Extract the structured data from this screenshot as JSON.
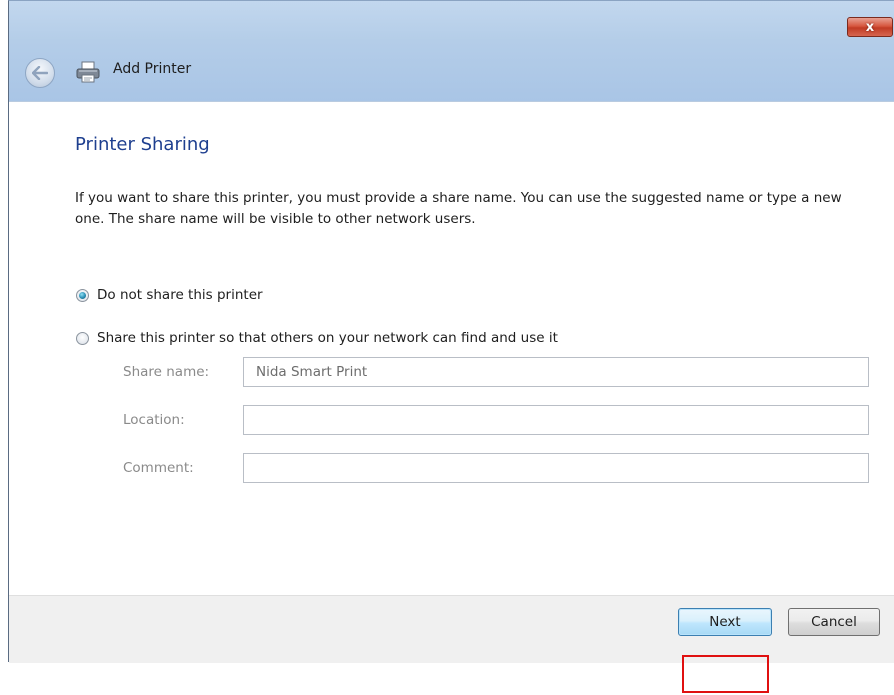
{
  "window": {
    "title": "Add Printer",
    "close_glyph": "x",
    "icons": {
      "back": "back-arrow-icon",
      "printer": "printer-icon",
      "close": "close-icon"
    }
  },
  "page": {
    "heading": "Printer Sharing",
    "description": "If you want to share this printer, you must provide a share name. You can use the suggested name or type a new one. The share name will be visible to other network users."
  },
  "sharing": {
    "options": [
      {
        "label": "Do not share this printer",
        "selected": true
      },
      {
        "label": "Share this printer so that others on your network can find and use it",
        "selected": false
      }
    ],
    "fields": {
      "share_name": {
        "label": "Share name:",
        "value": "Nida Smart Print"
      },
      "location": {
        "label": "Location:",
        "value": ""
      },
      "comment": {
        "label": "Comment:",
        "value": ""
      }
    }
  },
  "footer": {
    "next_label": "Next",
    "cancel_label": "Cancel"
  },
  "colors": {
    "heading": "#1e3f8f",
    "titlebar": "#b4cde8",
    "close_button": "#c13b24",
    "highlight": "#e01010",
    "disabled_label": "#8a8a8a"
  }
}
